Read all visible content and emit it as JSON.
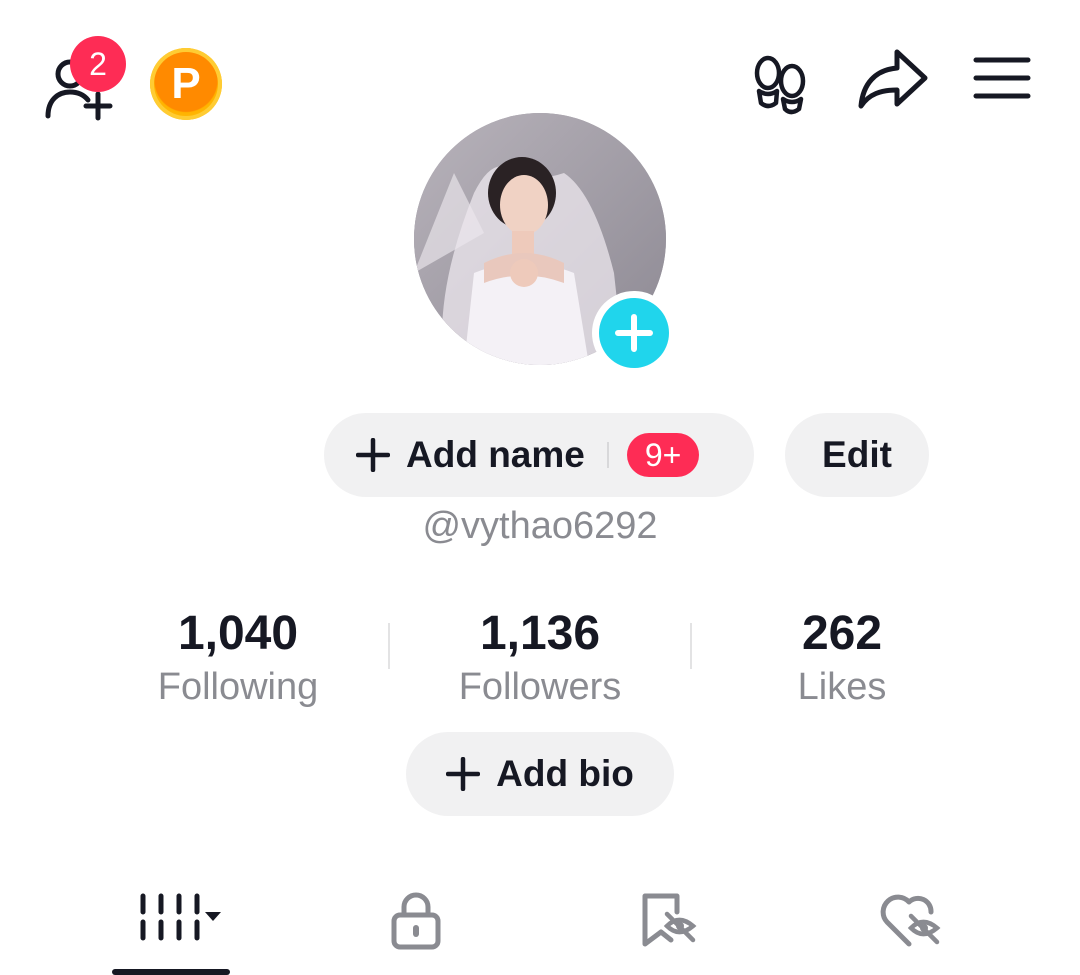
{
  "header": {
    "friend_requests_badge": "2",
    "coin_letter": "P",
    "icons": [
      "add-friend-icon",
      "coin-icon",
      "footprints-icon",
      "share-icon",
      "menu-icon"
    ]
  },
  "profile": {
    "add_name_label": "Add name",
    "name_badge": "9+",
    "edit_label": "Edit",
    "handle": "@vythao6292"
  },
  "stats": [
    {
      "value": "1,040",
      "label": "Following"
    },
    {
      "value": "1,136",
      "label": "Followers"
    },
    {
      "value": "262",
      "label": "Likes"
    }
  ],
  "add_bio_label": "Add bio",
  "tabs": [
    "videos-grid-icon",
    "lock-icon",
    "bookmark-hidden-icon",
    "liked-hidden-icon"
  ],
  "colors": {
    "accent_red": "#fe2c55",
    "accent_cyan": "#20d5ec",
    "coin_orange": "#ff8a00",
    "text_secondary": "#8a8b91"
  }
}
